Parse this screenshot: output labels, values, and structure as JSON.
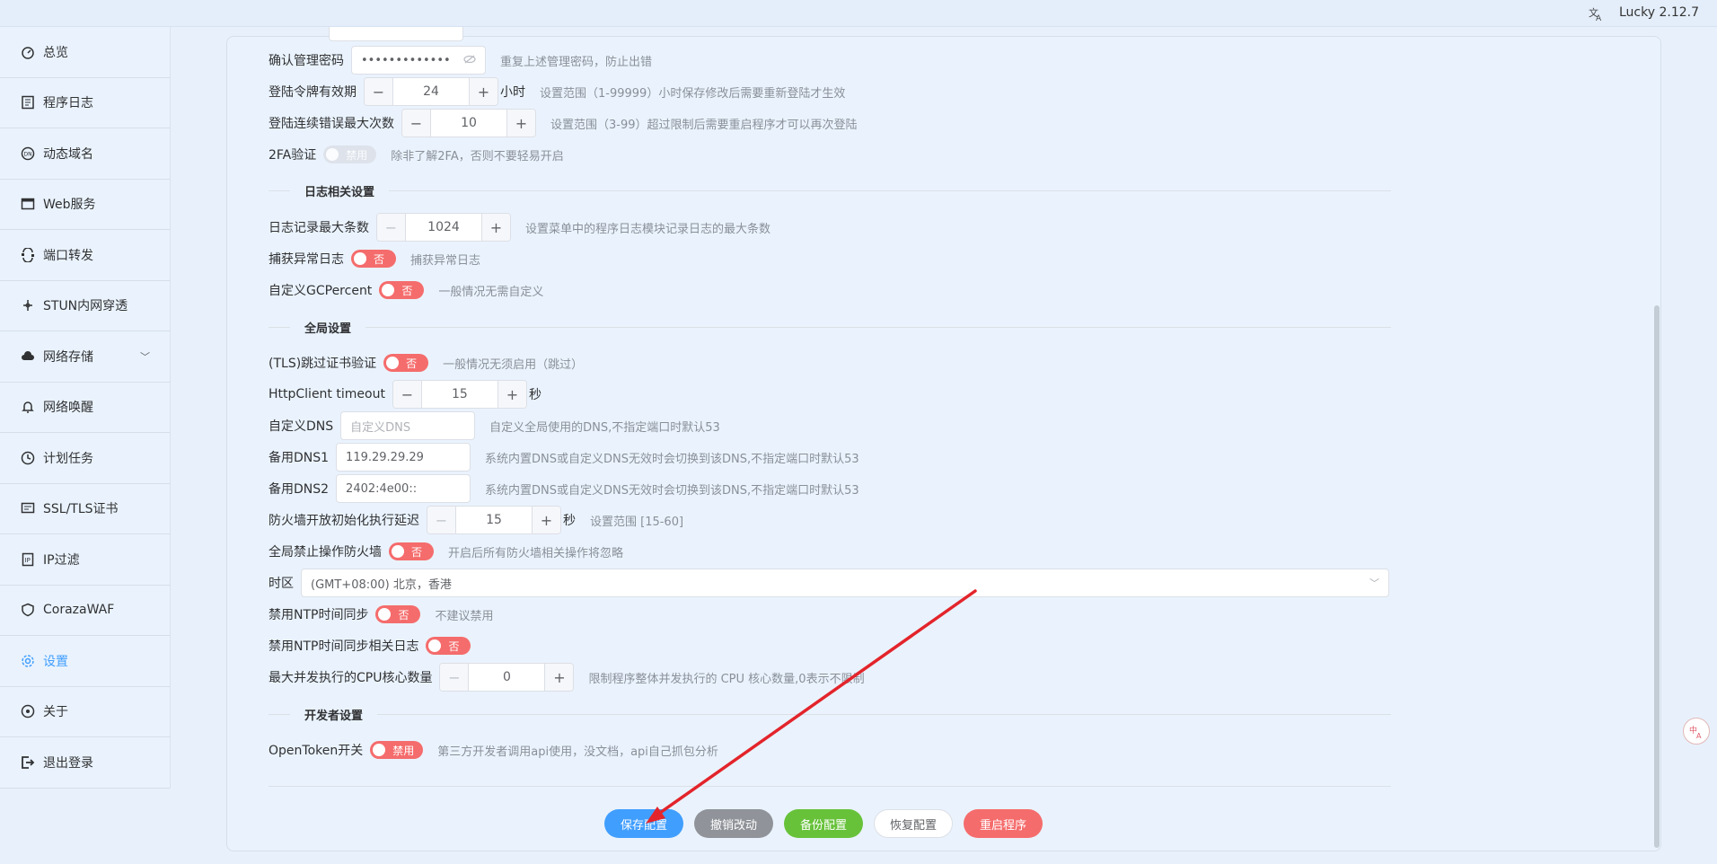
{
  "topbar": {
    "lang_icon": "translate-icon",
    "version": "Lucky 2.12.7"
  },
  "sidebar": {
    "items": [
      {
        "label": "总览",
        "icon": "dashboard-icon"
      },
      {
        "label": "程序日志",
        "icon": "log-icon"
      },
      {
        "label": "动态域名",
        "icon": "ddns-icon"
      },
      {
        "label": "Web服务",
        "icon": "web-icon"
      },
      {
        "label": "端口转发",
        "icon": "port-forward-icon"
      },
      {
        "label": "STUN内网穿透",
        "icon": "stun-icon"
      },
      {
        "label": "网络存储",
        "icon": "cloud-storage-icon"
      },
      {
        "label": "网络唤醒",
        "icon": "bell-icon"
      },
      {
        "label": "计划任务",
        "icon": "clock-icon"
      },
      {
        "label": "SSL/TLS证书",
        "icon": "certificate-icon"
      },
      {
        "label": "IP过滤",
        "icon": "ip-filter-icon"
      },
      {
        "label": "CorazaWAF",
        "icon": "shield-icon"
      },
      {
        "label": "设置",
        "icon": "gear-icon"
      },
      {
        "label": "关于",
        "icon": "about-icon"
      },
      {
        "label": "退出登录",
        "icon": "logout-icon"
      }
    ],
    "active": "设置"
  },
  "settings": {
    "confirm_pw": {
      "label": "确认管理密码",
      "value": "•••••••••••••",
      "hint": "重复上述管理密码，防止出错"
    },
    "token_valid": {
      "label": "登陆令牌有效期",
      "value": "24",
      "unit": "小时",
      "hint": "设置范围（1-99999）小时保存修改后需要重新登陆才生效"
    },
    "max_login_err": {
      "label": "登陆连续错误最大次数",
      "value": "10",
      "hint": "设置范围（3-99）超过限制后需要重启程序才可以再次登陆"
    },
    "twofa": {
      "label": "2FA验证",
      "switch": "禁用",
      "hint": "除非了解2FA，否则不要轻易开启"
    },
    "log_section": "日志相关设置",
    "log_max": {
      "label": "日志记录最大条数",
      "value": "1024",
      "hint": "设置菜单中的程序日志模块记录日志的最大条数"
    },
    "capture_err": {
      "label": "捕获异常日志",
      "switch": "否",
      "hint": "捕获异常日志"
    },
    "gc_percent": {
      "label": "自定义GCPercent",
      "switch": "否",
      "hint": "一般情况无需自定义"
    },
    "global_section": "全局设置",
    "tls_skip": {
      "label": "(TLS)跳过证书验证",
      "switch": "否",
      "hint": "一般情况无须启用（跳过）"
    },
    "http_timeout": {
      "label": "HttpClient timeout",
      "value": "15",
      "unit": "秒"
    },
    "custom_dns": {
      "label": "自定义DNS",
      "placeholder": "自定义DNS",
      "hint": "自定义全局使用的DNS,不指定端口时默认53"
    },
    "backup_dns1": {
      "label": "备用DNS1",
      "value": "119.29.29.29",
      "hint": "系统内置DNS或自定义DNS无效时会切换到该DNS,不指定端口时默认53"
    },
    "backup_dns2": {
      "label": "备用DNS2",
      "value": "2402:4e00::",
      "hint": "系统内置DNS或自定义DNS无效时会切换到该DNS,不指定端口时默认53"
    },
    "fw_delay": {
      "label": "防火墙开放初始化执行延迟",
      "value": "15",
      "unit": "秒",
      "hint": "设置范围 [15-60]"
    },
    "fw_disable": {
      "label": "全局禁止操作防火墙",
      "switch": "否",
      "hint": "开启后所有防火墙相关操作将忽略"
    },
    "timezone": {
      "label": "时区",
      "value": "(GMT+08:00) 北京，香港"
    },
    "ntp_disable": {
      "label": "禁用NTP时间同步",
      "switch": "否",
      "hint": "不建议禁用"
    },
    "ntp_log": {
      "label": "禁用NTP时间同步相关日志",
      "switch": "否"
    },
    "max_cpu": {
      "label": "最大并发执行的CPU核心数量",
      "value": "0",
      "hint": "限制程序整体并发执行的 CPU 核心数量,0表示不限制"
    },
    "dev_section": "开发者设置",
    "open_token": {
      "label": "OpenToken开关",
      "switch": "禁用",
      "hint": "第三方开发者调用api使用，没文档，api自己抓包分析"
    }
  },
  "actions": {
    "save": "保存配置",
    "revert": "撤销改动",
    "backup": "备份配置",
    "restore": "恢复配置",
    "restart": "重启程序"
  },
  "colors": {
    "primary": "#409eff",
    "danger": "#f56c6c",
    "success": "#67c23a",
    "info": "#909399",
    "annotation": "#e3242b"
  },
  "fab_icon": "translate-icon"
}
